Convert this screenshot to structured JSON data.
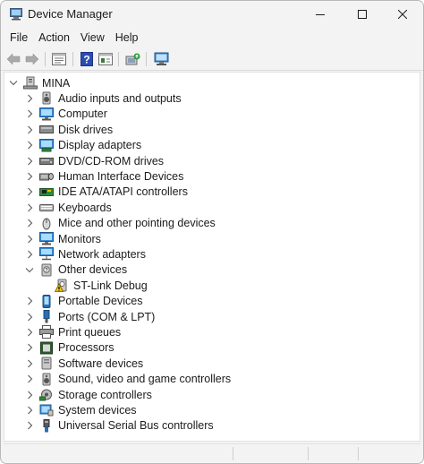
{
  "window": {
    "title": "Device Manager"
  },
  "menu": [
    "File",
    "Action",
    "View",
    "Help"
  ],
  "toolbar": [
    "back-arrow",
    "forward-arrow",
    "properties",
    "help",
    "show-hidden",
    "update-driver",
    "scan-hardware"
  ],
  "tree": {
    "root": "MINA",
    "categories": [
      {
        "label": "Audio inputs and outputs",
        "icon": "speaker-icon",
        "expanded": false
      },
      {
        "label": "Computer",
        "icon": "computer-icon",
        "expanded": false
      },
      {
        "label": "Disk drives",
        "icon": "disk-drive-icon",
        "expanded": false
      },
      {
        "label": "Display adapters",
        "icon": "display-adapter-icon",
        "expanded": false
      },
      {
        "label": "DVD/CD-ROM drives",
        "icon": "dvd-drive-icon",
        "expanded": false
      },
      {
        "label": "Human Interface Devices",
        "icon": "hid-icon",
        "expanded": false
      },
      {
        "label": "IDE ATA/ATAPI controllers",
        "icon": "ide-controller-icon",
        "expanded": false
      },
      {
        "label": "Keyboards",
        "icon": "keyboard-icon",
        "expanded": false
      },
      {
        "label": "Mice and other pointing devices",
        "icon": "mouse-icon",
        "expanded": false
      },
      {
        "label": "Monitors",
        "icon": "monitor-icon",
        "expanded": false
      },
      {
        "label": "Network adapters",
        "icon": "network-adapter-icon",
        "expanded": false
      },
      {
        "label": "Other devices",
        "icon": "other-device-icon",
        "expanded": true,
        "children": [
          {
            "label": "ST-Link Debug",
            "icon": "warning-device-icon"
          }
        ]
      },
      {
        "label": "Portable Devices",
        "icon": "portable-device-icon",
        "expanded": false
      },
      {
        "label": "Ports (COM & LPT)",
        "icon": "port-icon",
        "expanded": false
      },
      {
        "label": "Print queues",
        "icon": "printer-icon",
        "expanded": false
      },
      {
        "label": "Processors",
        "icon": "processor-icon",
        "expanded": false
      },
      {
        "label": "Software devices",
        "icon": "software-device-icon",
        "expanded": false
      },
      {
        "label": "Sound, video and game controllers",
        "icon": "sound-controller-icon",
        "expanded": false
      },
      {
        "label": "Storage controllers",
        "icon": "storage-controller-icon",
        "expanded": false
      },
      {
        "label": "System devices",
        "icon": "system-device-icon",
        "expanded": false
      },
      {
        "label": "Universal Serial Bus controllers",
        "icon": "usb-icon",
        "expanded": false
      }
    ]
  },
  "colors": {
    "accent": "#0078d4",
    "warning": "#f5c400"
  }
}
